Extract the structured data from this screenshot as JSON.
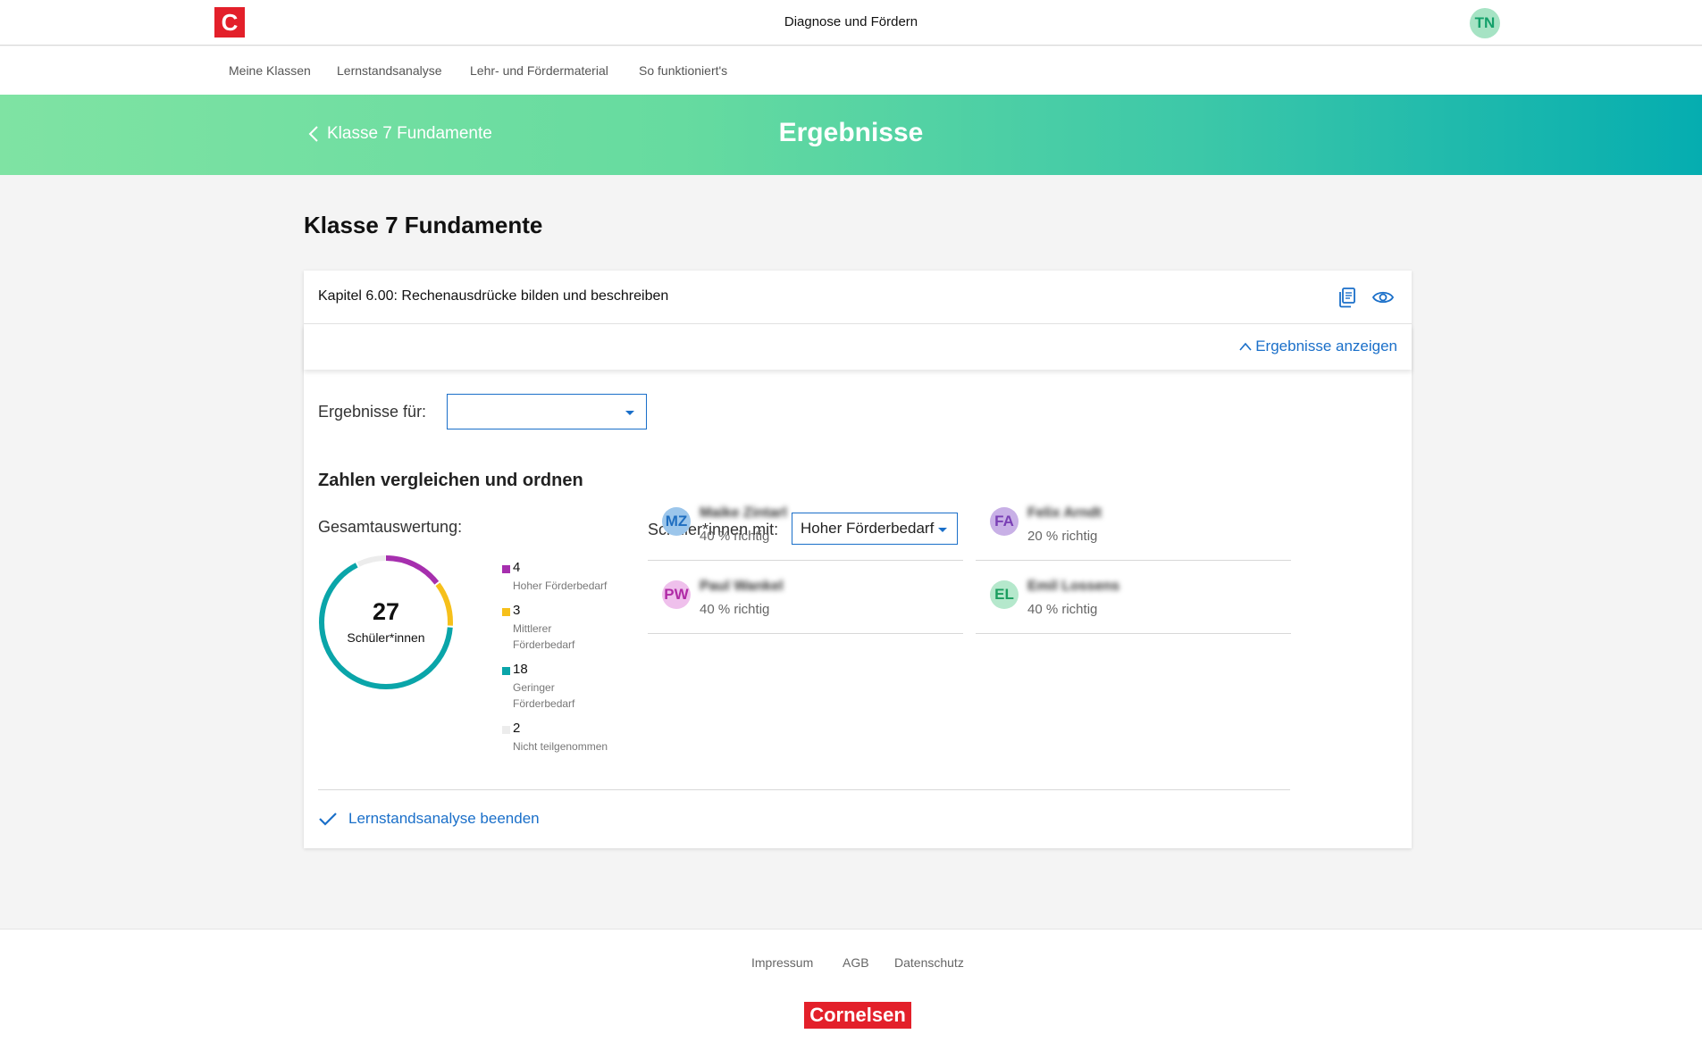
{
  "header": {
    "logo_letter": "C",
    "app_title": "Diagnose und Fördern",
    "user_initials": "TN"
  },
  "nav": {
    "items": [
      "Meine Klassen",
      "Lernstandsanalyse",
      "Lehr- und Fördermaterial",
      "So funktioniert's"
    ]
  },
  "hero": {
    "back_label": "Klasse 7 Fundamente",
    "title": "Ergebnisse"
  },
  "page": {
    "title": "Klasse 7 Fundamente"
  },
  "card": {
    "chapter_title": "Kapitel 6.00: Rechenausdrücke bilden und beschreiben",
    "toggle_label": "Ergebnisse anzeigen",
    "results_for_label": "Ergebnisse für:",
    "results_for_value": "",
    "section_title": "Zahlen vergleichen und ordnen",
    "overview_label": "Gesamtauswertung:",
    "total": "27",
    "total_caption": "Schüler*innen",
    "legend": [
      {
        "count": "4",
        "label": "Hoher Förderbedarf",
        "color": "#a62fae"
      },
      {
        "count": "3",
        "label": "Mittlerer Förderbedarf",
        "color": "#f6c01b"
      },
      {
        "count": "18",
        "label": "Geringer Förderbedarf",
        "color": "#0aa5a9"
      },
      {
        "count": "2",
        "label": "Nicht teilgenommen",
        "color": "#ececec"
      }
    ],
    "students_filter_label": "Schüler*innen mit:",
    "students_filter_value": "Hoher Förderbedarf",
    "students": [
      {
        "initials": "MZ",
        "name": "Maike Zintarl",
        "score": "40 % richtig",
        "bg": "#9cc6eb",
        "fg": "#1f6ec0"
      },
      {
        "initials": "FA",
        "name": "Felix Arndt",
        "score": "20 % richtig",
        "bg": "#c8b0e6",
        "fg": "#7a3fb5"
      },
      {
        "initials": "PW",
        "name": "Paul Wankel",
        "score": "40 % richtig",
        "bg": "#efc0ec",
        "fg": "#b02aa6"
      },
      {
        "initials": "EL",
        "name": "Emil Lossens",
        "score": "40 % richtig",
        "bg": "#b5e8cc",
        "fg": "#1b9e5f"
      }
    ],
    "finish_label": "Lernstandsanalyse beenden"
  },
  "footer": {
    "links": [
      "Impressum",
      "AGB",
      "Datenschutz"
    ],
    "brand": "Cornelsen"
  },
  "colors": {
    "accent_blue": "#1a6fc9",
    "brand_red": "#e3202a",
    "hero_gradient_start": "#7fe3a3",
    "hero_gradient_end": "#05adb0"
  }
}
